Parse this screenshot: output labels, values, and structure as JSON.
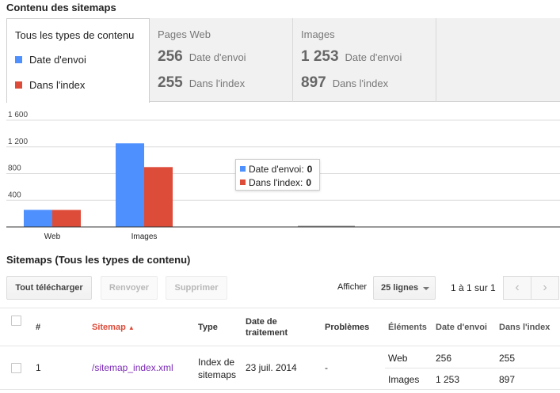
{
  "section_title": "Contenu des sitemaps",
  "tabs": {
    "all": {
      "title": "Tous les types de contenu",
      "legend": [
        {
          "label": "Date d'envoi",
          "color": "#4d90fe"
        },
        {
          "label": "Dans l'index",
          "color": "#dd4b39"
        }
      ]
    },
    "web": {
      "title": "Pages Web",
      "submitted": "256",
      "submitted_label": "Date d'envoi",
      "indexed": "255",
      "indexed_label": "Dans l'index"
    },
    "images": {
      "title": "Images",
      "submitted": "1 253",
      "submitted_label": "Date d'envoi",
      "indexed": "897",
      "indexed_label": "Dans l'index"
    }
  },
  "chart_data": {
    "type": "bar",
    "categories": [
      "Web",
      "Images",
      ""
    ],
    "series": [
      {
        "name": "Date d'envoi",
        "color": "#4d90fe",
        "values": [
          256,
          1253,
          0
        ]
      },
      {
        "name": "Dans l'index",
        "color": "#dd4b39",
        "values": [
          255,
          897,
          0
        ]
      }
    ],
    "y_ticks": [
      "400",
      "800",
      "1 200",
      "1 600"
    ],
    "y_tick_values": [
      400,
      800,
      1200,
      1600
    ],
    "ylim": [
      0,
      1600
    ],
    "grid": true
  },
  "tooltip": {
    "rows": [
      {
        "label": "Date d'envoi:",
        "value": "0",
        "color": "#4d90fe"
      },
      {
        "label": "Dans l'index:",
        "value": "0",
        "color": "#dd4b39"
      }
    ]
  },
  "list": {
    "title": "Sitemaps (Tous les types de contenu)",
    "buttons": {
      "download": "Tout télécharger",
      "resubmit": "Renvoyer",
      "delete": "Supprimer"
    },
    "show_label": "Afficher",
    "rows_select": "25 lignes",
    "pager_text": "1 à 1 sur 1"
  },
  "table": {
    "headers": {
      "num": "#",
      "sitemap": "Sitemap",
      "type": "Type",
      "date1": "Date de",
      "date2": "traitement",
      "problems": "Problèmes",
      "elements": "Éléments",
      "submitted": "Date d'envoi",
      "indexed": "Dans l'index"
    },
    "rows": [
      {
        "num": "1",
        "sitemap": "/sitemap_index.xml",
        "type1": "Index de",
        "type2": "sitemaps",
        "date": "23 juil. 2014",
        "problems": "-",
        "elements": [
          {
            "name": "Web",
            "submitted": "256",
            "indexed": "255"
          },
          {
            "name": "Images",
            "submitted": "1 253",
            "indexed": "897"
          }
        ]
      }
    ]
  }
}
